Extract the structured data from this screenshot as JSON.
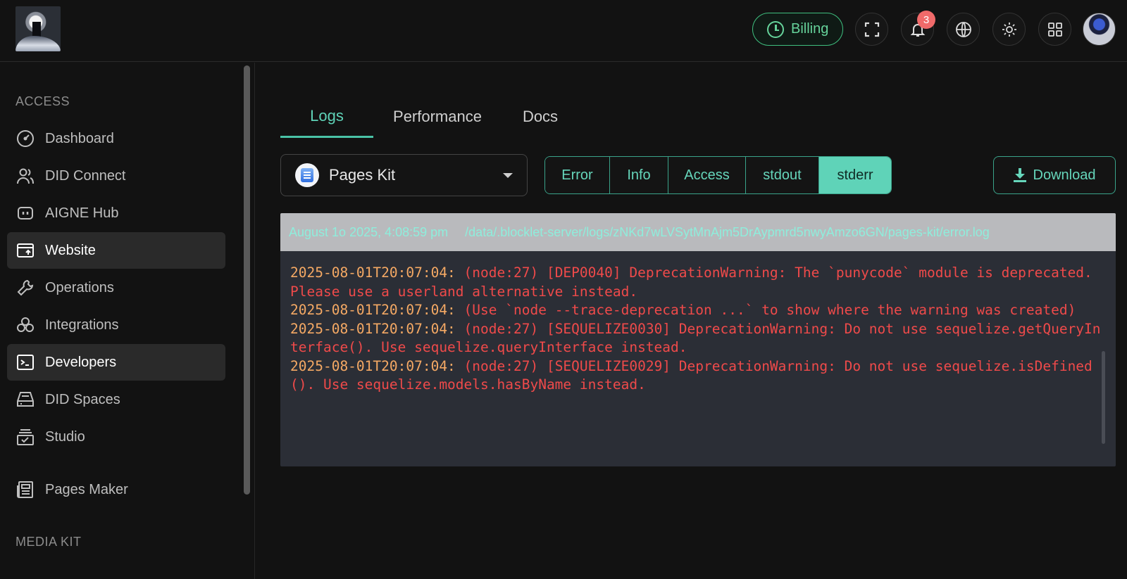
{
  "header": {
    "billing_label": "Billing",
    "notifications_count": "3",
    "icons": [
      "fullscreen-icon",
      "bell-icon",
      "globe-icon",
      "sun-icon",
      "apps-grid-icon"
    ]
  },
  "sidebar": {
    "section_access": "ACCESS",
    "items": [
      {
        "label": "Dashboard",
        "icon": "dashboard-icon"
      },
      {
        "label": "DID Connect",
        "icon": "users-icon"
      },
      {
        "label": "AIGNE Hub",
        "icon": "robot-icon"
      },
      {
        "label": "Website",
        "icon": "website-icon"
      },
      {
        "label": "Operations",
        "icon": "wrench-icon"
      },
      {
        "label": "Integrations",
        "icon": "integrations-icon"
      },
      {
        "label": "Developers",
        "icon": "terminal-icon"
      },
      {
        "label": "DID Spaces",
        "icon": "storage-icon"
      },
      {
        "label": "Studio",
        "icon": "studio-icon"
      },
      {
        "label": "Pages Maker",
        "icon": "newspaper-icon"
      }
    ],
    "section_media": "MEDIA KIT"
  },
  "tabs": [
    {
      "label": "Logs"
    },
    {
      "label": "Performance"
    },
    {
      "label": "Docs"
    }
  ],
  "app_select": {
    "value": "Pages Kit"
  },
  "filters": [
    {
      "label": "Error"
    },
    {
      "label": "Info"
    },
    {
      "label": "Access"
    },
    {
      "label": "stdout"
    },
    {
      "label": "stderr"
    }
  ],
  "download_label": "Download",
  "log": {
    "date": "August 1o 2025, 4:08:59 pm",
    "path": "/data/.blocklet-server/logs/zNKd7wLVSytMnAjm5DrAypmrd5nwyAmzo6GN/pages-kit/error.log",
    "entries": [
      {
        "ts": "2025-08-01T20:07:04:",
        "msg": " (node:27) [DEP0040] DeprecationWarning: The `punycode` module is deprecated. Please use a userland alternative instead."
      },
      {
        "ts": "2025-08-01T20:07:04:",
        "msg": " (Use `node --trace-deprecation ...` to show where the warning was created)"
      },
      {
        "ts": "2025-08-01T20:07:04:",
        "msg": " (node:27) [SEQUELIZE0030] DeprecationWarning: Do not use sequelize.getQueryInterface(). Use sequelize.queryInterface instead."
      },
      {
        "ts": "2025-08-01T20:07:04:",
        "msg": " (node:27) [SEQUELIZE0029] DeprecationWarning: Do not use sequelize.isDefined(). Use sequelize.models.hasByName instead."
      }
    ]
  },
  "colors": {
    "accent": "#5fd3b8",
    "billing": "#66d39b",
    "log_timestamp": "#f5a964",
    "log_error": "#ef4a4a",
    "badge": "#f06a6a"
  }
}
